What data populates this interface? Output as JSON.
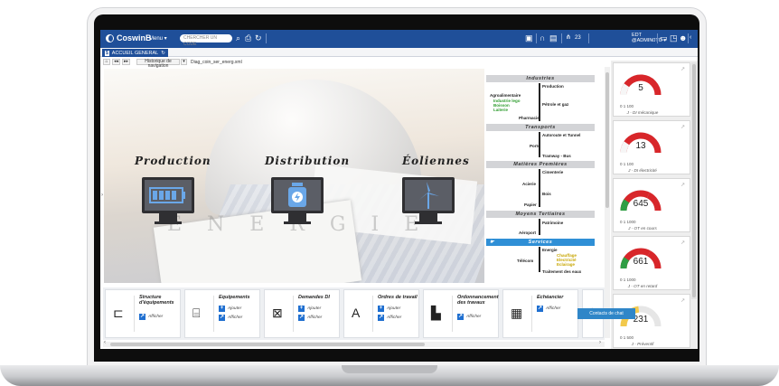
{
  "topbar": {
    "logo": "CoswinB",
    "menu": "Menu ▾",
    "search_placeholder": "CHERCHER UN CODE",
    "counter": "23",
    "user_line1": "EDT",
    "user_line2": "@ADMIN0TO ▾"
  },
  "tab": {
    "dollar": "$",
    "label": "ACCUEIL GENERAL"
  },
  "crumbs": {
    "back": "◂◂",
    "forward": "▸▸",
    "history_label": "Historique de navigation",
    "dropdown": "▾",
    "path": "Diag_coin_ser_energ.xml"
  },
  "hero": {
    "labels": [
      "Production",
      "Distribution",
      "Éoliennes"
    ],
    "watermark": "ÉNERGIE"
  },
  "tree": {
    "sections": [
      {
        "title": "Industries",
        "active": false
      },
      {
        "title": "Transports",
        "active": false
      },
      {
        "title": "Matières Premières",
        "active": false
      },
      {
        "title": "Moyens Tertiaires",
        "active": false
      },
      {
        "title": "Services",
        "active": true
      }
    ],
    "nodes": {
      "production": "Production",
      "agro": "Agroalimentaire",
      "agro_sub1": "Industrie lego",
      "agro_sub2": "Boisson",
      "agro_sub3": "Laiterie",
      "petrole": "Pétrole et gaz",
      "pharma": "Pharmacie",
      "autoroute": "Autoroute et Tunnel",
      "ports": "Ports",
      "tramway": "Tramway - Bus",
      "cimenterie": "Cimenterie",
      "acierie": "Acierie",
      "bois": "Bois",
      "papier": "Papier",
      "patrimoine": "Patrimoine",
      "aeroport": "Aéroport",
      "energie": "Energie",
      "telecom": "Télécom",
      "energie_sub1": "Chauffage",
      "energie_sub2": "Electricité",
      "energie_sub3": "Eclairage",
      "traitement": "Traitement des eaux"
    }
  },
  "tiles": [
    {
      "title": "Structure d'équipements",
      "icon": "hierarchy-icon",
      "glyph": "⊏",
      "actions": [
        "Afficher"
      ]
    },
    {
      "title": "Equipements",
      "icon": "equipment-icon",
      "glyph": "⌸",
      "actions": [
        "Ajouter",
        "Afficher"
      ]
    },
    {
      "title": "Demandes DI",
      "icon": "request-icon",
      "glyph": "⊠",
      "actions": [
        "Ajouter",
        "Afficher"
      ]
    },
    {
      "title": "Ordres de travail",
      "icon": "work-order-icon",
      "glyph": "A",
      "actions": [
        "Ajouter",
        "Afficher"
      ]
    },
    {
      "title": "Ordonnancement des travaux",
      "icon": "scheduling-icon",
      "glyph": "▙",
      "actions": [
        "Afficher"
      ]
    },
    {
      "title": "Echéancier",
      "icon": "calendar-icon",
      "glyph": "▦",
      "actions": [
        "Afficher"
      ]
    },
    {
      "title": "",
      "icon": "gear-icon",
      "glyph": "⚙",
      "actions": []
    }
  ],
  "gauges": [
    {
      "value": "5",
      "scale": "0      1      100",
      "label": "J - DI mécanique",
      "fill": 0.05,
      "color": "#d8262a",
      "level": 0.05
    },
    {
      "value": "13",
      "scale": "0      1      100",
      "label": "J - DI électricité",
      "fill": 0.13,
      "color": "#d8262a",
      "level": 0.13
    },
    {
      "value": "645",
      "scale": "0      1      1000",
      "label": "J - OT en cours",
      "fill": 0.645,
      "color": "#d8262a",
      "level": 0.645
    },
    {
      "value": "661",
      "scale": "0      1      1000",
      "label": "J - OT en retard",
      "fill": 0.661,
      "color": "#d8262a",
      "level": 0.661
    },
    {
      "value": "231",
      "scale": "0      1      500",
      "label": "J - Préventif",
      "fill": 0.462,
      "color": "#f2c94c",
      "level": 0.462
    }
  ],
  "chat_label": "Contacts de chat"
}
